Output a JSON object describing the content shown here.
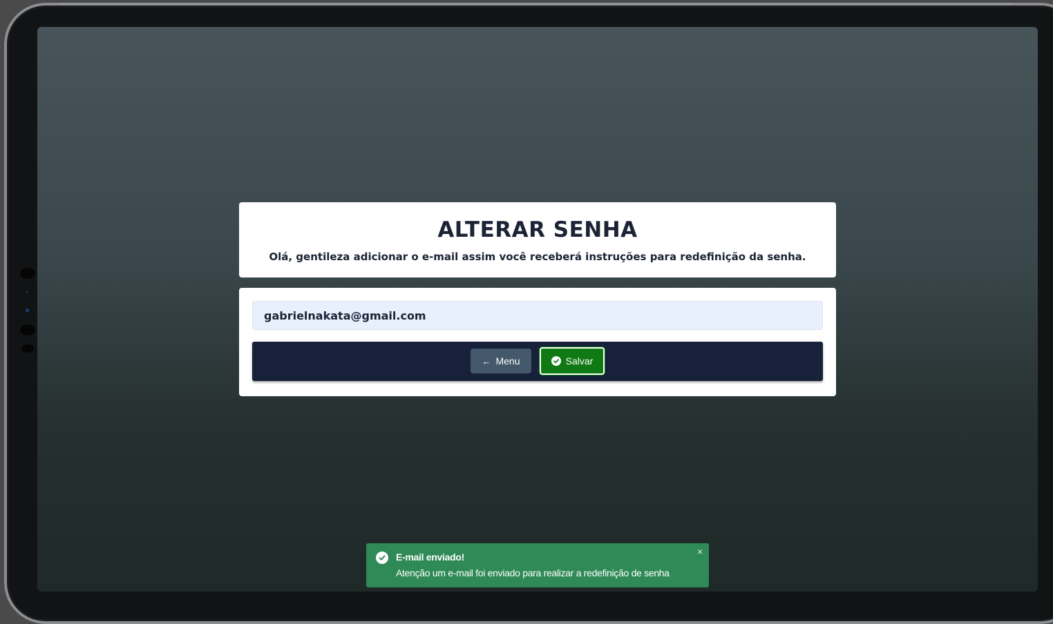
{
  "header": {
    "title": "ALTERAR SENHA",
    "subtitle": "Olá, gentileza adicionar o e-mail assim você receberá instruções para redefinição da senha."
  },
  "form": {
    "email_value": "gabrielnakata@gmail.com"
  },
  "toolbar": {
    "menu_label": "Menu",
    "menu_icon": "arrow-left-icon",
    "save_label": "Salvar",
    "save_icon": "check-circle-icon"
  },
  "toast": {
    "title": "E-mail enviado!",
    "message": "Atenção um e-mail foi enviado para realizar a redefinição de senha",
    "close_glyph": "×",
    "icon": "check-circle-icon"
  },
  "colors": {
    "toolbar_bg": "#17213a",
    "save_button": "#0f7a13",
    "menu_button": "#43586b",
    "toast_bg": "#2f8a57",
    "input_bg": "#e8f0fe",
    "text_dark": "#1b2334"
  }
}
